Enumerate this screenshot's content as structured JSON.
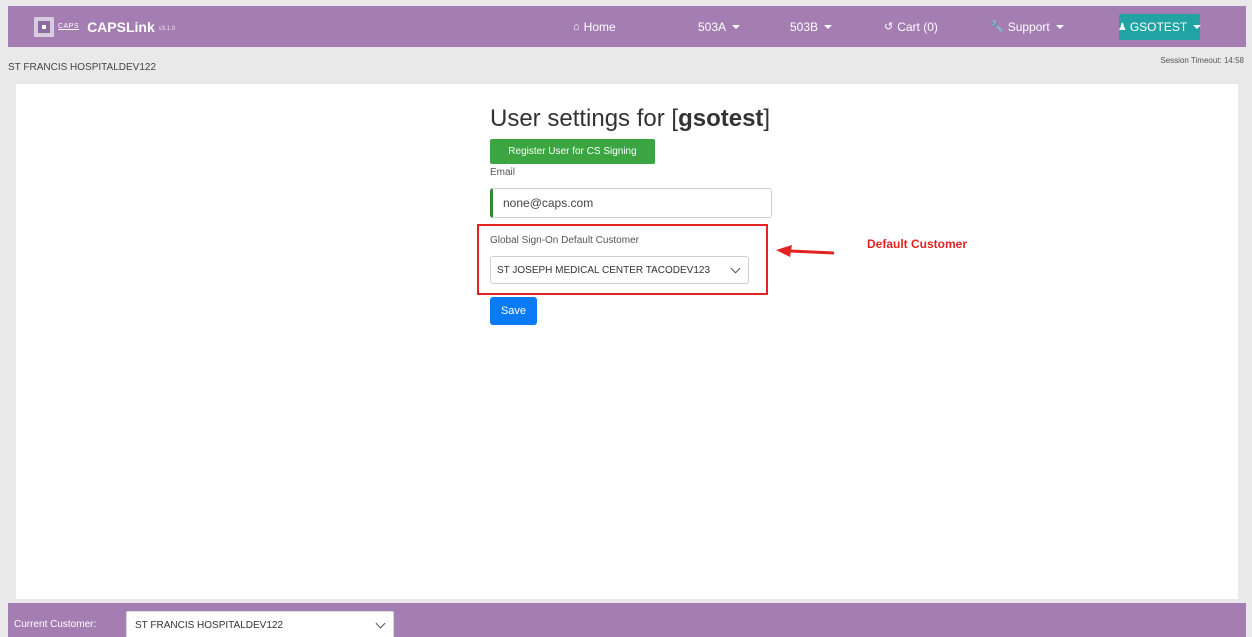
{
  "brand": {
    "logo_text": "CAPS",
    "logo_sub": "",
    "name": "CAPSLink",
    "version": "v3.1.0"
  },
  "nav": {
    "home": "Home",
    "menu_503a": "503A",
    "menu_503b": "503B",
    "cart": "Cart (0)",
    "support": "Support",
    "user": "GSOTEST"
  },
  "subheader": {
    "hospital": "ST FRANCIS HOSPITALDEV122",
    "session_timeout": "Session Timeout: 14:58"
  },
  "main": {
    "title_prefix": "User settings for [",
    "title_user": "gsotest",
    "title_suffix": "]",
    "register_button": "Register User for CS Signing",
    "email_label": "Email",
    "email_value": "none@caps.com",
    "gso_label": "Global Sign-On Default Customer",
    "gso_selected": "ST JOSEPH MEDICAL CENTER TACODEV123",
    "save_button": "Save"
  },
  "annotation": {
    "text": "Default Customer",
    "color": "#e32222"
  },
  "footer": {
    "label": "Current Customer:",
    "selected": "ST FRANCIS HOSPITALDEV122"
  },
  "colors": {
    "nav_bg": "#a47db3",
    "user_btn": "#22a3a3",
    "register_btn": "#3aa541",
    "save_btn": "#0a7bf5"
  }
}
